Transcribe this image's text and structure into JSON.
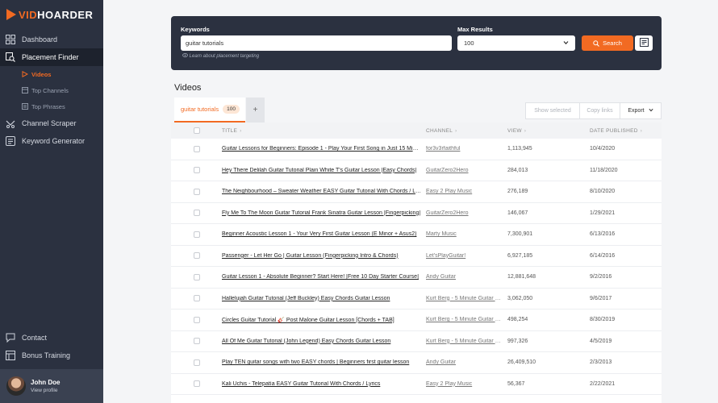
{
  "brand": {
    "vid": "VID",
    "hoarder": "HOARDER"
  },
  "sidebar": {
    "items": [
      {
        "label": "Dashboard"
      },
      {
        "label": "Placement Finder"
      },
      {
        "label": "Channel Scraper"
      },
      {
        "label": "Keyword Generator"
      }
    ],
    "subitems": [
      {
        "label": "Videos"
      },
      {
        "label": "Top Channels"
      },
      {
        "label": "Top Phrases"
      }
    ],
    "bottom": [
      {
        "label": "Contact"
      },
      {
        "label": "Bonus Training"
      }
    ],
    "profile": {
      "name": "John Doe",
      "link": "View profile"
    }
  },
  "search": {
    "keywords_label": "Keywords",
    "keywords_value": "guitar tutorials",
    "learn_text": "Learn about placement targeting",
    "max_label": "Max Results",
    "max_value": "100",
    "button_label": "Search"
  },
  "videos": {
    "title": "Videos",
    "tab_label": "guitar tutorials",
    "tab_count": "100",
    "add_tab": "+",
    "show_selected": "Show selected",
    "copy_links": "Copy links",
    "export": "Export"
  },
  "table": {
    "headers": {
      "title": "TITLE",
      "channel": "CHANNEL",
      "view": "VIEW",
      "date": "DATE PUBLISHED"
    },
    "rows": [
      {
        "title": "Guitar Lessons for Beginners: Episode 1 - Play Your First Song in Just 15 Minutes!",
        "channel": "for3v3rfaithful",
        "view": "1,113,945",
        "date": "10/4/2020"
      },
      {
        "title": "Hey There Delilah Guitar Tutorial Plain White T's Guitar Lesson |Easy Chords|",
        "channel": "GuitarZero2Hero",
        "view": "284,013",
        "date": "11/18/2020"
      },
      {
        "title": "The Neighbourhood – Sweater Weather EASY Guitar Tutorial With Chords / Lyrics",
        "channel": "Easy 2 Play Music",
        "view": "276,189",
        "date": "8/10/2020"
      },
      {
        "title": "Fly Me To The Moon Guitar Tutorial Frank Sinatra Guitar Lesson |Fingerpicking|",
        "channel": "GuitarZero2Hero",
        "view": "146,067",
        "date": "1/29/2021"
      },
      {
        "title": "Beginner Acoustic Lesson 1 - Your Very First Guitar Lesson (E Minor + Asus2)",
        "channel": "Marty Music",
        "view": "7,300,901",
        "date": "6/13/2016"
      },
      {
        "title": "Passenger - Let Her Go | Guitar Lesson (Fingerpicking Intro & Chords)",
        "channel": "Let'sPlayGuitar!",
        "view": "6,927,185",
        "date": "6/14/2016"
      },
      {
        "title": "Guitar Lesson 1 - Absolute Beginner? Start Here! [Free 10 Day Starter Course]",
        "channel": "Andy Guitar",
        "view": "12,881,648",
        "date": "9/2/2016"
      },
      {
        "title": "Hallelujah Guitar Tutorial (Jeff Buckley) Easy Chords Guitar Lesson",
        "channel": "Kurt Berg - 5 Minute Guitar Lessons",
        "view": "3,062,050",
        "date": "9/6/2017"
      },
      {
        "title": "Circles Guitar Tutorial 🎸 Post Malone Guitar Lesson [Chords + TAB]",
        "channel": "Kurt Berg - 5 Minute Guitar Lessons",
        "view": "498,254",
        "date": "8/30/2019"
      },
      {
        "title": "All Of Me Guitar Tutorial (John Legend) Easy Chords Guitar Lesson",
        "channel": "Kurt Berg - 5 Minute Guitar Lessons",
        "view": "997,326",
        "date": "4/5/2019"
      },
      {
        "title": "Play TEN guitar songs with two EASY chords | Beginners first guitar lesson",
        "channel": "Andy Guitar",
        "view": "26,409,510",
        "date": "2/3/2013"
      },
      {
        "title": "Kali Uchis - Telepatía EASY Guitar Tutorial With Chords / Lyrics",
        "channel": "Easy 2 Play Music",
        "view": "56,367",
        "date": "2/22/2021"
      }
    ]
  },
  "colors": {
    "accent": "#f26a22",
    "sidebar": "#2b3140",
    "panel": "#2b3140"
  }
}
